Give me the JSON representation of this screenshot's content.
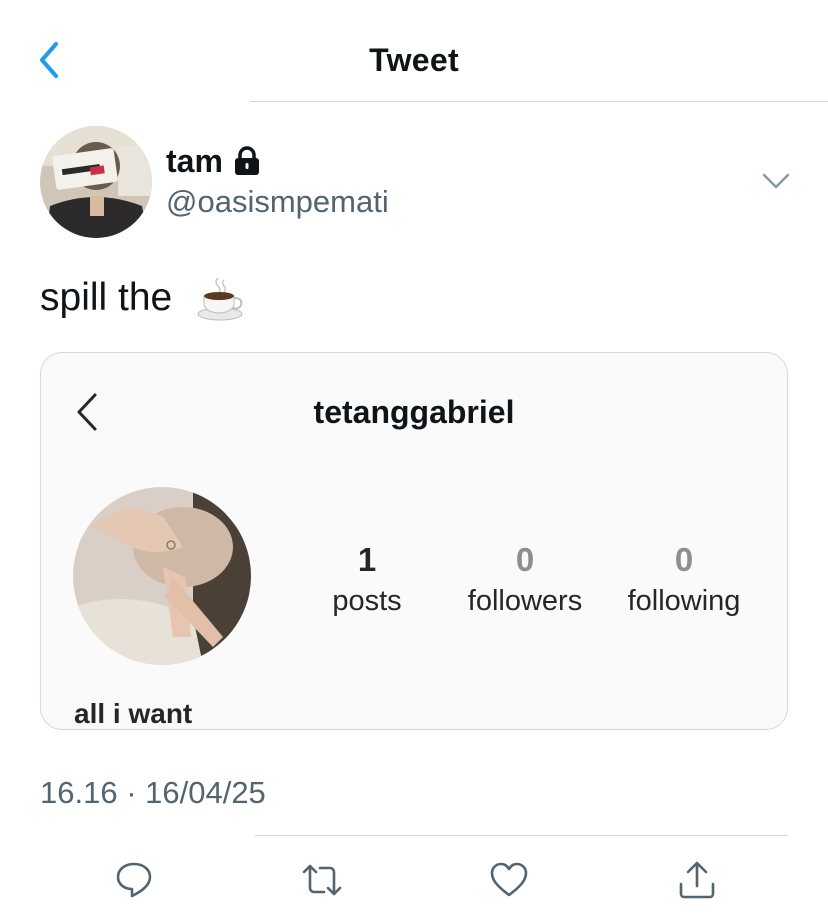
{
  "header": {
    "title": "Tweet"
  },
  "author": {
    "display_name": "tam",
    "handle": "@oasismpemati",
    "protected": true
  },
  "tweet": {
    "text": "spill the",
    "emoji": "☕",
    "timestamp": "16.16 · 16/04/25"
  },
  "embed": {
    "username": "tetanggabriel",
    "stats": [
      {
        "value": "1",
        "label": "posts"
      },
      {
        "value": "0",
        "label": "followers"
      },
      {
        "value": "0",
        "label": "following"
      }
    ],
    "bio_name": "all i want"
  },
  "icons": {
    "back": "chevron-left-icon",
    "lock": "lock-icon",
    "more": "chevron-down-icon",
    "reply": "reply-icon",
    "retweet": "retweet-icon",
    "like": "heart-icon",
    "share": "share-icon"
  },
  "colors": {
    "accent": "#1d9bf0",
    "secondary_text": "#536471",
    "divider": "#cfd9de"
  }
}
